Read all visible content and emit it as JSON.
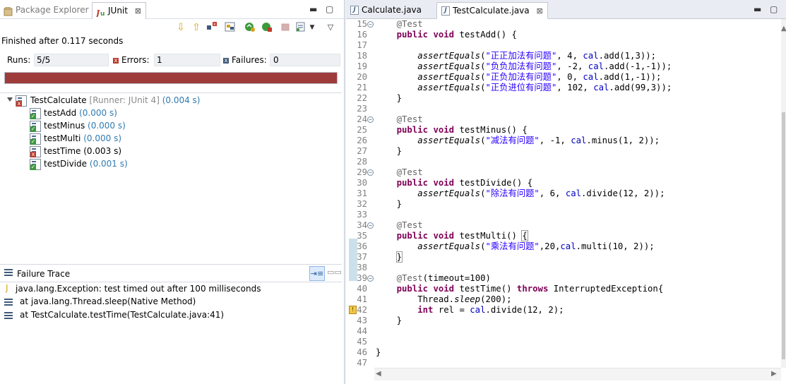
{
  "left": {
    "tabs": [
      {
        "label": "Package Explorer",
        "icon": "package-explorer-icon"
      },
      {
        "label": "JUnit",
        "icon": "junit-icon"
      }
    ],
    "close_glyph": "⊠",
    "finished": "Finished after 0.117 seconds",
    "counts": {
      "runs_label": "Runs:",
      "runs_value": "5/5",
      "errors_label": "Errors:",
      "errors_value": "1",
      "failures_label": "Failures:",
      "failures_value": "0"
    },
    "progress": {
      "fraction": 1.0,
      "color": "#9e3b3b"
    },
    "tree": {
      "root": {
        "name": "TestCalculate",
        "runner": "[Runner: JUnit 4]",
        "time": "(0.004 s)"
      },
      "items": [
        {
          "name": "testAdd",
          "time": "(0.000 s)",
          "status": "pass"
        },
        {
          "name": "testMinus",
          "time": "(0.000 s)",
          "status": "pass"
        },
        {
          "name": "testMulti",
          "time": "(0.000 s)",
          "status": "pass"
        },
        {
          "name": "testTime",
          "time": "(0.003 s)",
          "status": "error"
        },
        {
          "name": "testDivide",
          "time": "(0.001 s)",
          "status": "pass"
        }
      ]
    },
    "failure_trace": {
      "title": "Failure Trace",
      "lines": [
        "java.lang.Exception: test timed out after 100 milliseconds",
        "at java.lang.Thread.sleep(Native Method)",
        "at TestCalculate.testTime(TestCalculate.java:41)"
      ]
    }
  },
  "editor": {
    "tabs": [
      {
        "label": "Calculate.java",
        "active": false
      },
      {
        "label": "TestCalculate.java",
        "active": true
      }
    ],
    "line_numbers": [
      "15",
      "16",
      "17",
      "18",
      "19",
      "20",
      "21",
      "22",
      "23",
      "24",
      "25",
      "26",
      "27",
      "28",
      "29",
      "30",
      "31",
      "32",
      "33",
      "34",
      "35",
      "36",
      "37",
      "38",
      "39",
      "40",
      "41",
      "42",
      "43",
      "44",
      "45",
      "46",
      "47"
    ],
    "strings": {
      "s18": "\"正正加法有问题\"",
      "s19": "\"负负加法有问题\"",
      "s20": "\"正负加法有问题\"",
      "s21": "\"正负进位有问题\"",
      "s26": "\"减法有问题\"",
      "s31": "\"除法有问题\"",
      "s36": "\"乘法有问题\""
    }
  },
  "colors": {
    "error_red": "#c0392b",
    "pass_green": "#3c9a3c",
    "time_blue": "#2f7bb1",
    "keyword": "#7f0055",
    "string": "#2a00ff",
    "field": "#0000c0"
  }
}
